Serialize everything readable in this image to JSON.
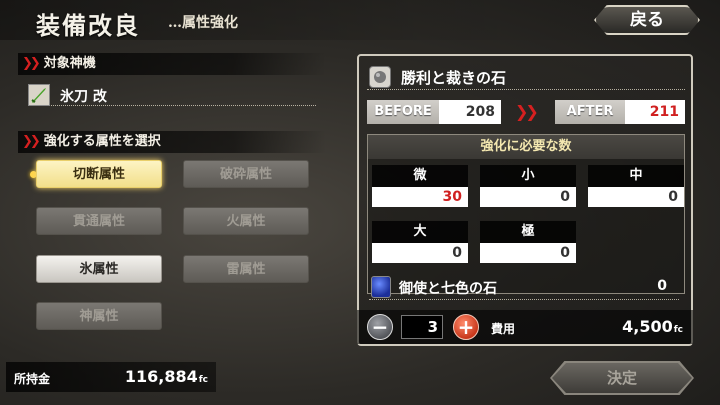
{
  "header": {
    "title": "装備改良",
    "subtitle": "…属性強化",
    "back_label": "戻る"
  },
  "target_section": {
    "label": "対象神機",
    "weapon_name": "氷刀 改"
  },
  "attribute_section": {
    "label": "強化する属性を選択",
    "options": [
      {
        "label": "切断属性",
        "state": "selected"
      },
      {
        "label": "破砕属性",
        "state": "disabled"
      },
      {
        "label": "貫通属性",
        "state": "disabled"
      },
      {
        "label": "火属性",
        "state": "disabled"
      },
      {
        "label": "氷属性",
        "state": "enabled"
      },
      {
        "label": "雷属性",
        "state": "disabled"
      },
      {
        "label": "神属性",
        "state": "disabled"
      }
    ]
  },
  "money": {
    "label": "所持金",
    "value": "116,884",
    "unit": "fc"
  },
  "stone": {
    "name": "勝利と裁きの石",
    "before_label": "BEFORE",
    "before_value": "208",
    "after_label": "AFTER",
    "after_value": "211"
  },
  "requirements": {
    "title": "強化に必要な数",
    "cells": [
      {
        "label": "微",
        "value": "30"
      },
      {
        "label": "小",
        "value": "0"
      },
      {
        "label": "中",
        "value": "0"
      },
      {
        "label": "大",
        "value": "0"
      },
      {
        "label": "極",
        "value": "0"
      }
    ],
    "extra_item": {
      "name": "御使と七色の石",
      "value": "0"
    }
  },
  "cost": {
    "minus": "−",
    "plus": "+",
    "quantity": "3",
    "label": "費用",
    "value": "4,500",
    "unit": "fc"
  },
  "confirm_label": "決定",
  "colors": {
    "highlight_red": "#d02020",
    "selected_gold": "#f2df8a"
  }
}
